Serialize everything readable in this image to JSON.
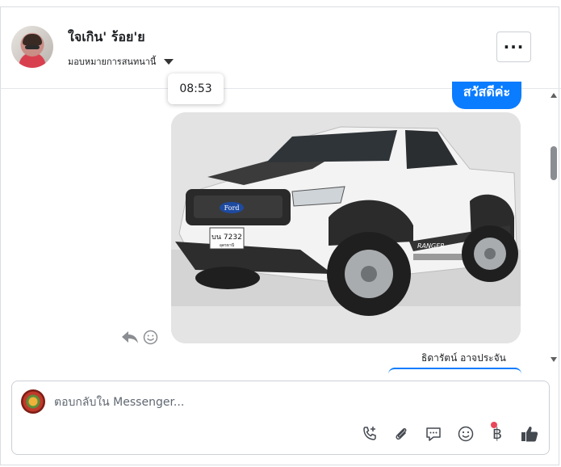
{
  "header": {
    "contact_name": "ใจเกิน' ร้อย'ย",
    "assign_label": "มอบหมายการสนทนานี้",
    "more_icon": "more-horizontal-icon"
  },
  "conversation": {
    "timestamp_tooltip": "08:53",
    "greeting_message": "สวัสดีค่ะ",
    "image_plate_line1": "บน 7232",
    "image_plate_line2": "อุดรธานี",
    "image_brand_badge": "Ford",
    "image_side_decal": "RANGER",
    "sender_name": "ธิดารัตน์ อาจประจัน"
  },
  "composer": {
    "placeholder": "ตอบกลับใน Messenger...",
    "tools": [
      "phone-plus-icon",
      "paperclip-icon",
      "saved-reply-icon",
      "emoji-icon",
      "baht-payment-icon",
      "thumbs-up-icon"
    ],
    "baht_symbol": "฿",
    "notification_color": "#e9475a"
  },
  "colors": {
    "accent": "#0a7cff",
    "text": "#1c1e21"
  }
}
